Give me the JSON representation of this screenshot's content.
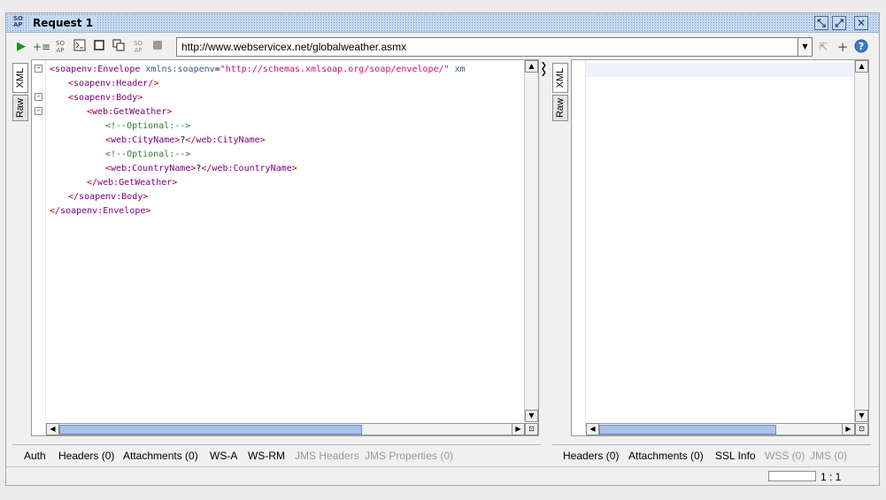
{
  "window": {
    "title": "Request 1",
    "icon_text": "SO\nAP",
    "controls": [
      "restore-icon",
      "maximize-icon",
      "close-icon"
    ]
  },
  "toolbar": {
    "buttons": [
      "run-icon",
      "add-assertion-icon",
      "soap-icon",
      "format-icon",
      "tab-icon",
      "copy-icon",
      "soap-icon",
      "stop-icon"
    ],
    "url": "http://www.webservicex.net/globalweather.asmx",
    "right_buttons": [
      "endpoint-icon",
      "add-icon",
      "help-icon"
    ]
  },
  "request_editor": {
    "tabs": [
      "XML",
      "Raw"
    ],
    "active_tab": "XML",
    "lines": [
      {
        "indent": 0,
        "parts": [
          [
            "tag",
            "<"
          ],
          [
            "tname",
            "soapenv:Envelope"
          ],
          [
            "txt",
            " "
          ],
          [
            "attr",
            "xmlns:soapenv"
          ],
          [
            "txt",
            "="
          ],
          [
            "str",
            "\"http://schemas.xmlsoap.org/soap/envelope/\""
          ],
          [
            "txt",
            " "
          ],
          [
            "attr",
            "xm"
          ]
        ],
        "fold": true
      },
      {
        "indent": 1,
        "parts": [
          [
            "tag",
            "<"
          ],
          [
            "tname",
            "soapenv:Header"
          ],
          [
            "tag",
            "/>"
          ]
        ],
        "fold": false
      },
      {
        "indent": 1,
        "parts": [
          [
            "tag",
            "<"
          ],
          [
            "tname",
            "soapenv:Body"
          ],
          [
            "tag",
            ">"
          ]
        ],
        "fold": true
      },
      {
        "indent": 2,
        "parts": [
          [
            "tag",
            "<"
          ],
          [
            "tname",
            "web:GetWeather"
          ],
          [
            "tag",
            ">"
          ]
        ],
        "fold": true
      },
      {
        "indent": 3,
        "parts": [
          [
            "cmt",
            "<!--Optional:-->"
          ]
        ],
        "fold": false
      },
      {
        "indent": 3,
        "parts": [
          [
            "tag",
            "<"
          ],
          [
            "tname",
            "web:CityName"
          ],
          [
            "tag",
            ">"
          ],
          [
            "txt",
            "?"
          ],
          [
            "tag",
            "</"
          ],
          [
            "tname",
            "web:CityName"
          ],
          [
            "tag",
            ">"
          ]
        ],
        "fold": false
      },
      {
        "indent": 3,
        "parts": [
          [
            "cmt",
            "<!--Optional:-->"
          ]
        ],
        "fold": false
      },
      {
        "indent": 3,
        "parts": [
          [
            "tag",
            "<"
          ],
          [
            "tname",
            "web:CountryName"
          ],
          [
            "tag",
            ">"
          ],
          [
            "txt",
            "?"
          ],
          [
            "tag",
            "</"
          ],
          [
            "tname",
            "web:CountryName"
          ],
          [
            "tag",
            ">"
          ]
        ],
        "fold": false
      },
      {
        "indent": 2,
        "parts": [
          [
            "tag",
            "</"
          ],
          [
            "tname",
            "web:GetWeather"
          ],
          [
            "tag",
            ">"
          ]
        ],
        "fold": false
      },
      {
        "indent": 1,
        "parts": [
          [
            "tag",
            "</"
          ],
          [
            "tname",
            "soapenv:Body"
          ],
          [
            "tag",
            ">"
          ]
        ],
        "fold": false
      },
      {
        "indent": 0,
        "parts": [
          [
            "tag",
            "</"
          ],
          [
            "tname",
            "soapenv:Envelope"
          ],
          [
            "tag",
            ">"
          ]
        ],
        "fold": false
      }
    ]
  },
  "response_editor": {
    "tabs": [
      "XML",
      "Raw"
    ],
    "active_tab": "XML"
  },
  "request_bottom_tabs": [
    {
      "label": "Auth",
      "enabled": true
    },
    {
      "label": "Headers (0)",
      "enabled": true
    },
    {
      "label": "Attachments (0)",
      "enabled": true
    },
    {
      "label": "WS-A",
      "enabled": true
    },
    {
      "label": "WS-RM",
      "enabled": true
    },
    {
      "label": "JMS Headers",
      "enabled": false
    },
    {
      "label": "JMS Properties (0)",
      "enabled": false
    }
  ],
  "response_bottom_tabs": [
    {
      "label": "Headers (0)",
      "enabled": true
    },
    {
      "label": "Attachments (0)",
      "enabled": true
    },
    {
      "label": "SSL Info",
      "enabled": true
    },
    {
      "label": "WSS (0)",
      "enabled": false
    },
    {
      "label": "JMS (0)",
      "enabled": false
    }
  ],
  "status": {
    "cursor_position": "1 : 1"
  },
  "colors": {
    "title_bar": "#c5d9f1",
    "tag": "#b4001e",
    "tag_name": "#7a0080",
    "attribute": "#3a5a8a",
    "string": "#c2127a",
    "comment": "#2d7a2d"
  }
}
